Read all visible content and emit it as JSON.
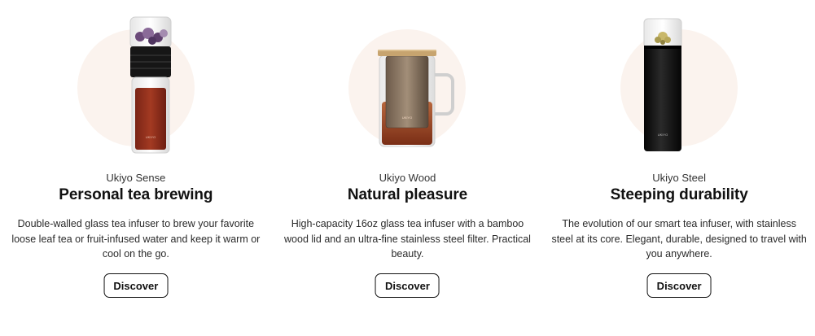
{
  "products": [
    {
      "subtitle": "Ukiyo Sense",
      "title": "Personal tea brewing",
      "description": "Double-walled glass tea infuser to brew your favorite loose leaf tea or fruit-infused water and keep it warm or cool on the go.",
      "button": "Discover",
      "image_icon": "glass-tea-bottle-icon",
      "brand_mark": "UKIYO"
    },
    {
      "subtitle": "Ukiyo Wood",
      "title": "Natural pleasure",
      "description": "High-capacity 16oz glass tea infuser with a bamboo wood lid and an ultra-fine stainless steel filter. Practical beauty.",
      "button": "Discover",
      "image_icon": "glass-tea-mug-icon",
      "brand_mark": "UKIYO"
    },
    {
      "subtitle": "Ukiyo Steel",
      "title": "Steeping durability",
      "description": "The evolution of our smart tea infuser, with stainless steel at its core. Elegant, durable, designed to travel with you anywhere.",
      "button": "Discover",
      "image_icon": "steel-tea-bottle-icon",
      "brand_mark": "UKIYO"
    }
  ],
  "colors": {
    "circle_bg": "#fbf3ee",
    "text": "#111111",
    "button_border": "#111111"
  }
}
